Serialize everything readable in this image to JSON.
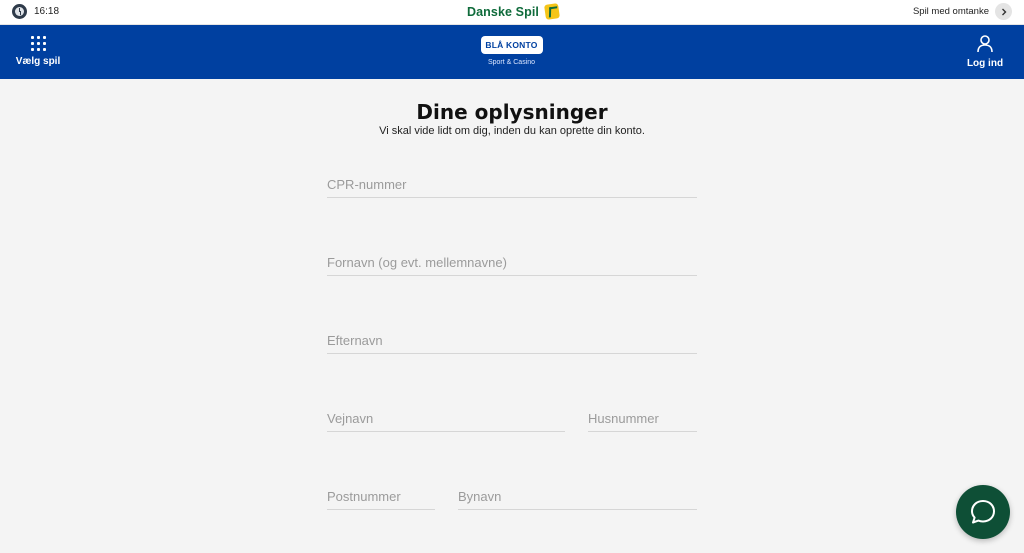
{
  "statusbar": {
    "time": "16:18",
    "brand": "Danske Spil",
    "responsible_label": "Spil med omtanke"
  },
  "navbar": {
    "games_label": "Vælg spil",
    "account_badge": "BLÅ KONTO",
    "account_subtitle": "Sport & Casino",
    "login_label": "Log ind"
  },
  "form": {
    "title": "Dine oplysninger",
    "subtitle": "Vi skal vide lidt om dig, inden du kan oprette din konto.",
    "cpr_placeholder": "CPR-nummer",
    "first_name_placeholder": "Fornavn (og evt. mellemnavne)",
    "last_name_placeholder": "Efternavn",
    "street_placeholder": "Vejnavn",
    "house_number_placeholder": "Husnummer",
    "postal_code_placeholder": "Postnummer",
    "city_placeholder": "Bynavn"
  },
  "colors": {
    "nav_blue": "#0040a0",
    "brand_green": "#0f6b3b",
    "chat_green": "#0e4f36",
    "logo_yellow": "#f5c518",
    "page_background": "#f4f4f4"
  },
  "icons": {
    "clock": "clock-icon",
    "brand_logo": "danske-spil-logo",
    "chevron": "chevron-right-icon",
    "games": "grid-icon",
    "login": "user-icon",
    "chat": "chat-bubble-icon"
  }
}
